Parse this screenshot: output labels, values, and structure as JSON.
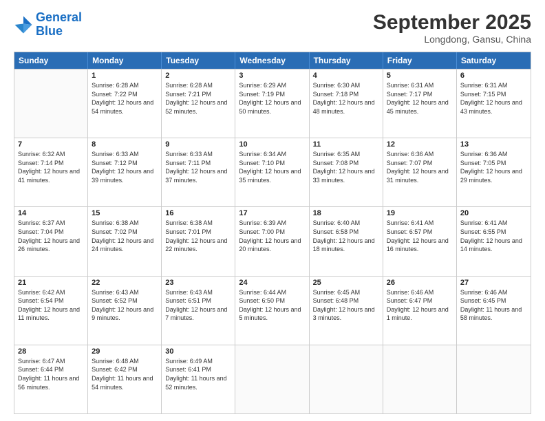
{
  "header": {
    "logo_line1": "General",
    "logo_line2": "Blue",
    "title": "September 2025",
    "subtitle": "Longdong, Gansu, China"
  },
  "calendar": {
    "days_of_week": [
      "Sunday",
      "Monday",
      "Tuesday",
      "Wednesday",
      "Thursday",
      "Friday",
      "Saturday"
    ],
    "weeks": [
      [
        {
          "day": "",
          "empty": true
        },
        {
          "day": "1",
          "sunrise": "6:28 AM",
          "sunset": "7:22 PM",
          "daylight": "12 hours and 54 minutes."
        },
        {
          "day": "2",
          "sunrise": "6:28 AM",
          "sunset": "7:21 PM",
          "daylight": "12 hours and 52 minutes."
        },
        {
          "day": "3",
          "sunrise": "6:29 AM",
          "sunset": "7:19 PM",
          "daylight": "12 hours and 50 minutes."
        },
        {
          "day": "4",
          "sunrise": "6:30 AM",
          "sunset": "7:18 PM",
          "daylight": "12 hours and 48 minutes."
        },
        {
          "day": "5",
          "sunrise": "6:31 AM",
          "sunset": "7:17 PM",
          "daylight": "12 hours and 45 minutes."
        },
        {
          "day": "6",
          "sunrise": "6:31 AM",
          "sunset": "7:15 PM",
          "daylight": "12 hours and 43 minutes."
        }
      ],
      [
        {
          "day": "7",
          "sunrise": "6:32 AM",
          "sunset": "7:14 PM",
          "daylight": "12 hours and 41 minutes."
        },
        {
          "day": "8",
          "sunrise": "6:33 AM",
          "sunset": "7:12 PM",
          "daylight": "12 hours and 39 minutes."
        },
        {
          "day": "9",
          "sunrise": "6:33 AM",
          "sunset": "7:11 PM",
          "daylight": "12 hours and 37 minutes."
        },
        {
          "day": "10",
          "sunrise": "6:34 AM",
          "sunset": "7:10 PM",
          "daylight": "12 hours and 35 minutes."
        },
        {
          "day": "11",
          "sunrise": "6:35 AM",
          "sunset": "7:08 PM",
          "daylight": "12 hours and 33 minutes."
        },
        {
          "day": "12",
          "sunrise": "6:36 AM",
          "sunset": "7:07 PM",
          "daylight": "12 hours and 31 minutes."
        },
        {
          "day": "13",
          "sunrise": "6:36 AM",
          "sunset": "7:05 PM",
          "daylight": "12 hours and 29 minutes."
        }
      ],
      [
        {
          "day": "14",
          "sunrise": "6:37 AM",
          "sunset": "7:04 PM",
          "daylight": "12 hours and 26 minutes."
        },
        {
          "day": "15",
          "sunrise": "6:38 AM",
          "sunset": "7:02 PM",
          "daylight": "12 hours and 24 minutes."
        },
        {
          "day": "16",
          "sunrise": "6:38 AM",
          "sunset": "7:01 PM",
          "daylight": "12 hours and 22 minutes."
        },
        {
          "day": "17",
          "sunrise": "6:39 AM",
          "sunset": "7:00 PM",
          "daylight": "12 hours and 20 minutes."
        },
        {
          "day": "18",
          "sunrise": "6:40 AM",
          "sunset": "6:58 PM",
          "daylight": "12 hours and 18 minutes."
        },
        {
          "day": "19",
          "sunrise": "6:41 AM",
          "sunset": "6:57 PM",
          "daylight": "12 hours and 16 minutes."
        },
        {
          "day": "20",
          "sunrise": "6:41 AM",
          "sunset": "6:55 PM",
          "daylight": "12 hours and 14 minutes."
        }
      ],
      [
        {
          "day": "21",
          "sunrise": "6:42 AM",
          "sunset": "6:54 PM",
          "daylight": "12 hours and 11 minutes."
        },
        {
          "day": "22",
          "sunrise": "6:43 AM",
          "sunset": "6:52 PM",
          "daylight": "12 hours and 9 minutes."
        },
        {
          "day": "23",
          "sunrise": "6:43 AM",
          "sunset": "6:51 PM",
          "daylight": "12 hours and 7 minutes."
        },
        {
          "day": "24",
          "sunrise": "6:44 AM",
          "sunset": "6:50 PM",
          "daylight": "12 hours and 5 minutes."
        },
        {
          "day": "25",
          "sunrise": "6:45 AM",
          "sunset": "6:48 PM",
          "daylight": "12 hours and 3 minutes."
        },
        {
          "day": "26",
          "sunrise": "6:46 AM",
          "sunset": "6:47 PM",
          "daylight": "12 hours and 1 minute."
        },
        {
          "day": "27",
          "sunrise": "6:46 AM",
          "sunset": "6:45 PM",
          "daylight": "11 hours and 58 minutes."
        }
      ],
      [
        {
          "day": "28",
          "sunrise": "6:47 AM",
          "sunset": "6:44 PM",
          "daylight": "11 hours and 56 minutes."
        },
        {
          "day": "29",
          "sunrise": "6:48 AM",
          "sunset": "6:42 PM",
          "daylight": "11 hours and 54 minutes."
        },
        {
          "day": "30",
          "sunrise": "6:49 AM",
          "sunset": "6:41 PM",
          "daylight": "11 hours and 52 minutes."
        },
        {
          "day": "",
          "empty": true
        },
        {
          "day": "",
          "empty": true
        },
        {
          "day": "",
          "empty": true
        },
        {
          "day": "",
          "empty": true
        }
      ]
    ]
  }
}
